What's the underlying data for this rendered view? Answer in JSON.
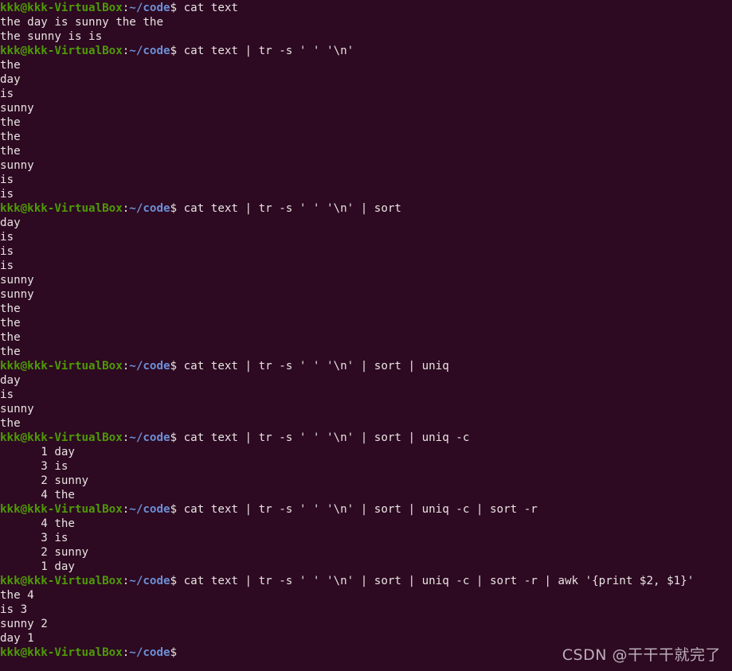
{
  "terminal": {
    "prompt": {
      "user_host": "kkk@kkk-VirtualBox",
      "colon": ":",
      "path": "~/code",
      "symbol": "$",
      "colors": {
        "background": "#2d0922",
        "user_host": "#4e9a06",
        "path": "#6c8fd4",
        "text": "#e8e4e0"
      }
    },
    "lines": [
      {
        "type": "prompt",
        "command": " cat text"
      },
      {
        "type": "output",
        "text": "the day is sunny the the"
      },
      {
        "type": "output",
        "text": "the sunny is is"
      },
      {
        "type": "prompt",
        "command": " cat text | tr -s ' ' '\\n'"
      },
      {
        "type": "output",
        "text": "the"
      },
      {
        "type": "output",
        "text": "day"
      },
      {
        "type": "output",
        "text": "is"
      },
      {
        "type": "output",
        "text": "sunny"
      },
      {
        "type": "output",
        "text": "the"
      },
      {
        "type": "output",
        "text": "the"
      },
      {
        "type": "output",
        "text": "the"
      },
      {
        "type": "output",
        "text": "sunny"
      },
      {
        "type": "output",
        "text": "is"
      },
      {
        "type": "output",
        "text": "is"
      },
      {
        "type": "prompt",
        "command": " cat text | tr -s ' ' '\\n' | sort"
      },
      {
        "type": "output",
        "text": "day"
      },
      {
        "type": "output",
        "text": "is"
      },
      {
        "type": "output",
        "text": "is"
      },
      {
        "type": "output",
        "text": "is"
      },
      {
        "type": "output",
        "text": "sunny"
      },
      {
        "type": "output",
        "text": "sunny"
      },
      {
        "type": "output",
        "text": "the"
      },
      {
        "type": "output",
        "text": "the"
      },
      {
        "type": "output",
        "text": "the"
      },
      {
        "type": "output",
        "text": "the"
      },
      {
        "type": "prompt",
        "command": " cat text | tr -s ' ' '\\n' | sort | uniq"
      },
      {
        "type": "output",
        "text": "day"
      },
      {
        "type": "output",
        "text": "is"
      },
      {
        "type": "output",
        "text": "sunny"
      },
      {
        "type": "output",
        "text": "the"
      },
      {
        "type": "prompt",
        "command": " cat text | tr -s ' ' '\\n' | sort | uniq -c"
      },
      {
        "type": "output",
        "text": "      1 day"
      },
      {
        "type": "output",
        "text": "      3 is"
      },
      {
        "type": "output",
        "text": "      2 sunny"
      },
      {
        "type": "output",
        "text": "      4 the"
      },
      {
        "type": "prompt",
        "command": " cat text | tr -s ' ' '\\n' | sort | uniq -c | sort -r"
      },
      {
        "type": "output",
        "text": "      4 the"
      },
      {
        "type": "output",
        "text": "      3 is"
      },
      {
        "type": "output",
        "text": "      2 sunny"
      },
      {
        "type": "output",
        "text": "      1 day"
      },
      {
        "type": "prompt",
        "command": " cat text | tr -s ' ' '\\n' | sort | uniq -c | sort -r | awk '{print $2, $1}'"
      },
      {
        "type": "output",
        "text": "the 4"
      },
      {
        "type": "output",
        "text": "is 3"
      },
      {
        "type": "output",
        "text": "sunny 2"
      },
      {
        "type": "output",
        "text": "day 1"
      },
      {
        "type": "prompt",
        "command": ""
      }
    ],
    "watermark": "CSDN @干干干就完了"
  }
}
